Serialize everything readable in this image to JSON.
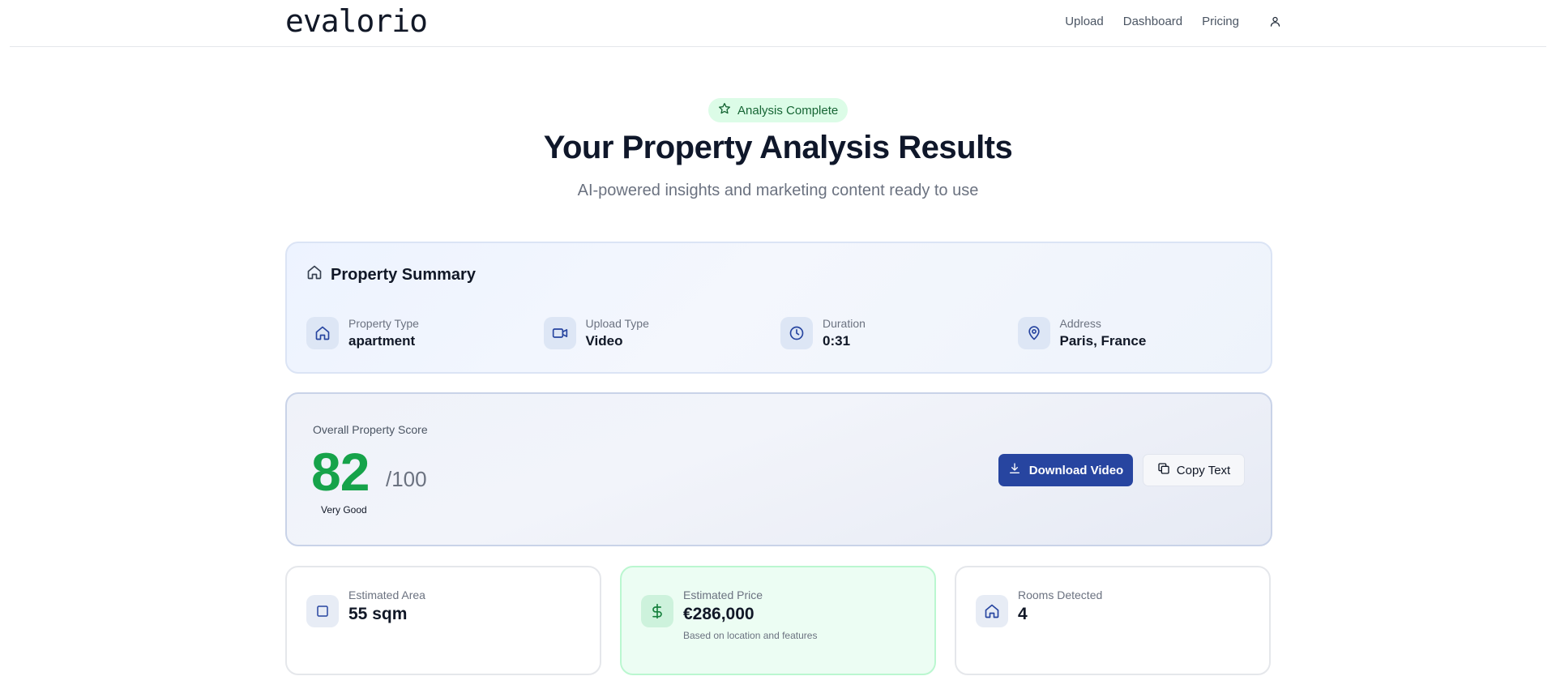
{
  "brand": {
    "logo": "evalorio"
  },
  "nav": {
    "links": [
      "Upload",
      "Dashboard",
      "Pricing"
    ],
    "user_icon": "user-icon"
  },
  "hero": {
    "badge": "Analysis Complete",
    "badge_icon": "star-icon",
    "title": "Your Property Analysis Results",
    "subtitle": "AI-powered insights and marketing content ready to use"
  },
  "summary": {
    "title": "Property Summary",
    "title_icon": "home-icon",
    "items": [
      {
        "label": "Property Type",
        "value": "apartment",
        "icon": "home-icon"
      },
      {
        "label": "Upload Type",
        "value": "Video",
        "icon": "video-camera-icon"
      },
      {
        "label": "Duration",
        "value": "0:31",
        "icon": "clock-icon"
      },
      {
        "label": "Address",
        "value": "Paris, France",
        "icon": "map-pin-icon"
      }
    ]
  },
  "score": {
    "label": "Overall Property Score",
    "value": "82",
    "denominator": "/100",
    "grade": "Very Good",
    "download_label": "Download Video",
    "copy_label": "Copy Text"
  },
  "stats": [
    {
      "label": "Estimated Area",
      "value": "55 sqm",
      "icon": "square-icon"
    },
    {
      "label": "Estimated Price",
      "value": "€286,000",
      "note": "Based on location and features",
      "icon": "dollar-icon"
    },
    {
      "label": "Rooms Detected",
      "value": "4",
      "icon": "home-icon"
    }
  ],
  "colors": {
    "accent": "#2745a0",
    "score_green": "#16a34a",
    "badge_bg": "#dcfce7",
    "badge_text": "#166534"
  }
}
